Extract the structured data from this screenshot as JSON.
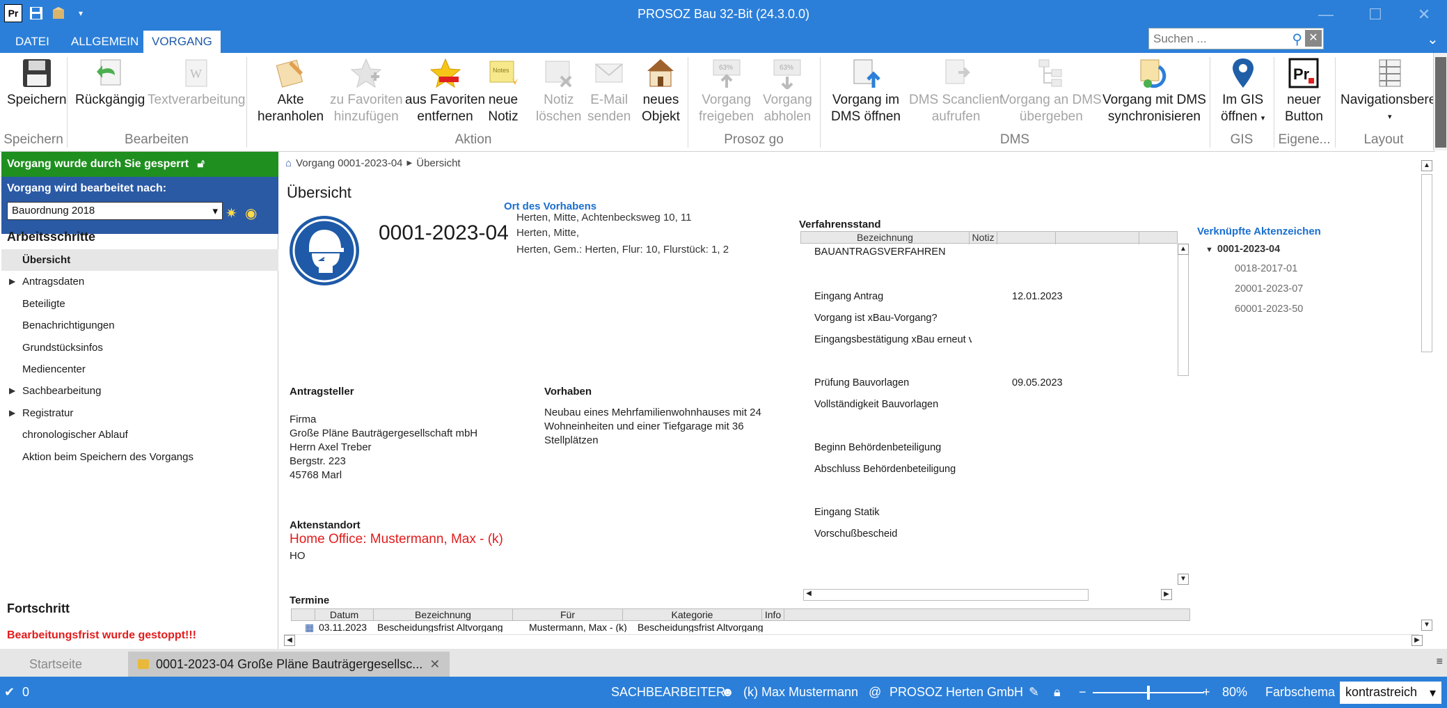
{
  "window": {
    "title": "PROSOZ Bau 32-Bit (24.3.0.0)",
    "app_logo": "Pr"
  },
  "ribbon_tabs": [
    "DATEI",
    "ALLGEMEIN",
    "VORGANG"
  ],
  "search": {
    "placeholder": "Suchen ..."
  },
  "ribbon": {
    "buttons": {
      "speichern": "Speichern",
      "rueckgaengig": "Rückgängig",
      "textverarbeitung": "Textverarbeitung",
      "akte_heranholen_1": "Akte",
      "akte_heranholen_2": "heranholen",
      "zu_fav_1": "zu Favoriten",
      "zu_fav_2": "hinzufügen",
      "aus_fav_1": "aus Favoriten",
      "aus_fav_2": "entfernen",
      "neue_notiz_1": "neue",
      "neue_notiz_2": "Notiz",
      "notiz_loeschen_1": "Notiz",
      "notiz_loeschen_2": "löschen",
      "email_1": "E-Mail",
      "email_2": "senden",
      "neues_objekt_1": "neues",
      "neues_objekt_2": "Objekt",
      "vorgang_freigeben_1": "Vorgang",
      "vorgang_freigeben_2": "freigeben",
      "vorgang_abholen_1": "Vorgang",
      "vorgang_abholen_2": "abholen",
      "dms_oeffnen_1": "Vorgang im",
      "dms_oeffnen_2": "DMS öffnen",
      "dms_scan_1": "DMS Scanclient",
      "dms_scan_2": "aufrufen",
      "dms_uebergeben_1": "Vorgang an DMS",
      "dms_uebergeben_2": "übergeben",
      "dms_sync_1": "Vorgang mit DMS",
      "dms_sync_2": "synchronisieren",
      "gis_1": "Im GIS",
      "gis_2": "öffnen",
      "neuer_button_1": "neuer",
      "neuer_button_2": "Button",
      "navigationsbereich": "Navigationsberei",
      "freigeben_percent": "63%",
      "abholen_percent": "63%"
    },
    "groups": {
      "speichern": "Speichern",
      "bearbeiten": "Bearbeiten",
      "aktion": "Aktion",
      "prosoz_go": "Prosoz go",
      "dms": "DMS",
      "gis": "GIS",
      "eigene": "Eigene...",
      "layout": "Layout"
    }
  },
  "left": {
    "locked": "Vorgang wurde durch Sie gesperrt",
    "edit_label": "Vorgang wird bearbeitet nach:",
    "edit_value": "Bauordnung 2018",
    "steps_heading": "Arbeitsschritte",
    "nav": [
      {
        "label": "Übersicht"
      },
      {
        "label": "Antragsdaten"
      },
      {
        "label": "Beteiligte"
      },
      {
        "label": "Benachrichtigungen"
      },
      {
        "label": "Grundstücksinfos"
      },
      {
        "label": "Mediencenter"
      },
      {
        "label": "Sachbearbeitung"
      },
      {
        "label": "Registratur"
      },
      {
        "label": "chronologischer Ablauf"
      },
      {
        "label": "Aktion beim Speichern des Vorgangs"
      }
    ],
    "progress_heading": "Fortschritt",
    "stopped": "Bearbeitungsfrist wurde gestoppt!!!"
  },
  "content": {
    "breadcrumb_case": "Vorgang 0001-2023-04",
    "breadcrumb_page": "Übersicht",
    "page_title": "Übersicht",
    "case_number": "0001-2023-04",
    "ort_heading": "Ort des Vorhabens",
    "ort_lines": [
      "Herten, Mitte, Achtenbecksweg 10, 11",
      "Herten, Mitte,",
      "Herten, Gem.: Herten, Flur: 10, Flurstück: 1, 2"
    ],
    "antragsteller_heading": "Antragsteller",
    "antragsteller_lines": [
      "Firma",
      "Große Pläne Bauträgergesellschaft mbH",
      "Herrn Axel Treber",
      "Bergstr. 223",
      "45768 Marl"
    ],
    "vorhaben_heading": "Vorhaben",
    "vorhaben_lines": [
      "Neubau eines Mehrfamilienwohnhauses mit 24",
      "Wohneinheiten und einer Tiefgarage mit 36",
      "Stellplätzen"
    ],
    "aktenstandort_heading": "Aktenstandort",
    "aktenstandort_value": "Home Office: Mustermann, Max - (k)",
    "aktenstandort_code": "HO",
    "verfahren_heading": "Verfahrensstand",
    "verfahren_cols": [
      "Bezeichnung",
      "Notiz"
    ],
    "verfahren_rows": [
      {
        "label": "BAUANTRAGSVERFAHREN",
        "date": ""
      },
      {
        "label": "Eingang Antrag",
        "date": "12.01.2023"
      },
      {
        "label": "Vorgang ist xBau-Vorgang?",
        "date": ""
      },
      {
        "label": "Eingangsbestätigung xBau erneut ve",
        "date": ""
      },
      {
        "label": "Prüfung  Bauvorlagen",
        "date": "09.05.2023"
      },
      {
        "label": "Vollständigkeit Bauvorlagen",
        "date": ""
      },
      {
        "label": "Beginn Behördenbeteiligung",
        "date": ""
      },
      {
        "label": "Abschluss Behördenbeteiligung",
        "date": ""
      },
      {
        "label": "Eingang Statik",
        "date": ""
      },
      {
        "label": "Vorschußbescheid",
        "date": ""
      }
    ],
    "linked_heading": "Verknüpfte Aktenzeichen",
    "linked_root": "0001-2023-04",
    "linked_children": [
      "0018-2017-01",
      "20001-2023-07",
      "60001-2023-50"
    ],
    "termine_heading": "Termine",
    "termine_cols": [
      "Datum",
      "Bezeichnung",
      "Für",
      "Kategorie",
      "Info"
    ],
    "termine_row": {
      "datum": "03.11.2023",
      "bezeichnung": "Bescheidungsfrist Altvorgang",
      "fuer": "Mustermann, Max - (k)",
      "kategorie": "Bescheidungsfrist Altvorgang"
    }
  },
  "doctabs": {
    "start": "Startseite",
    "active": "0001-2023-04 Große Pläne Bauträgergesellsc..."
  },
  "status": {
    "count": "0",
    "sachbearbeiter_label": "SACHBEARBEITER:",
    "user": "(k) Max Mustermann",
    "at": "@",
    "org": "PROSOZ Herten GmbH",
    "zoom": "80%",
    "zoom_level": 0.5,
    "farbschema_label": "Farbschema",
    "farbschema_value": "kontrastreich"
  },
  "colors": {
    "accent": "#2b7fd9",
    "locked_green": "#1f8f1f",
    "edit_blue": "#2b5aa5",
    "alert_red": "#e31b1b",
    "link_blue": "#1a6fcf"
  }
}
